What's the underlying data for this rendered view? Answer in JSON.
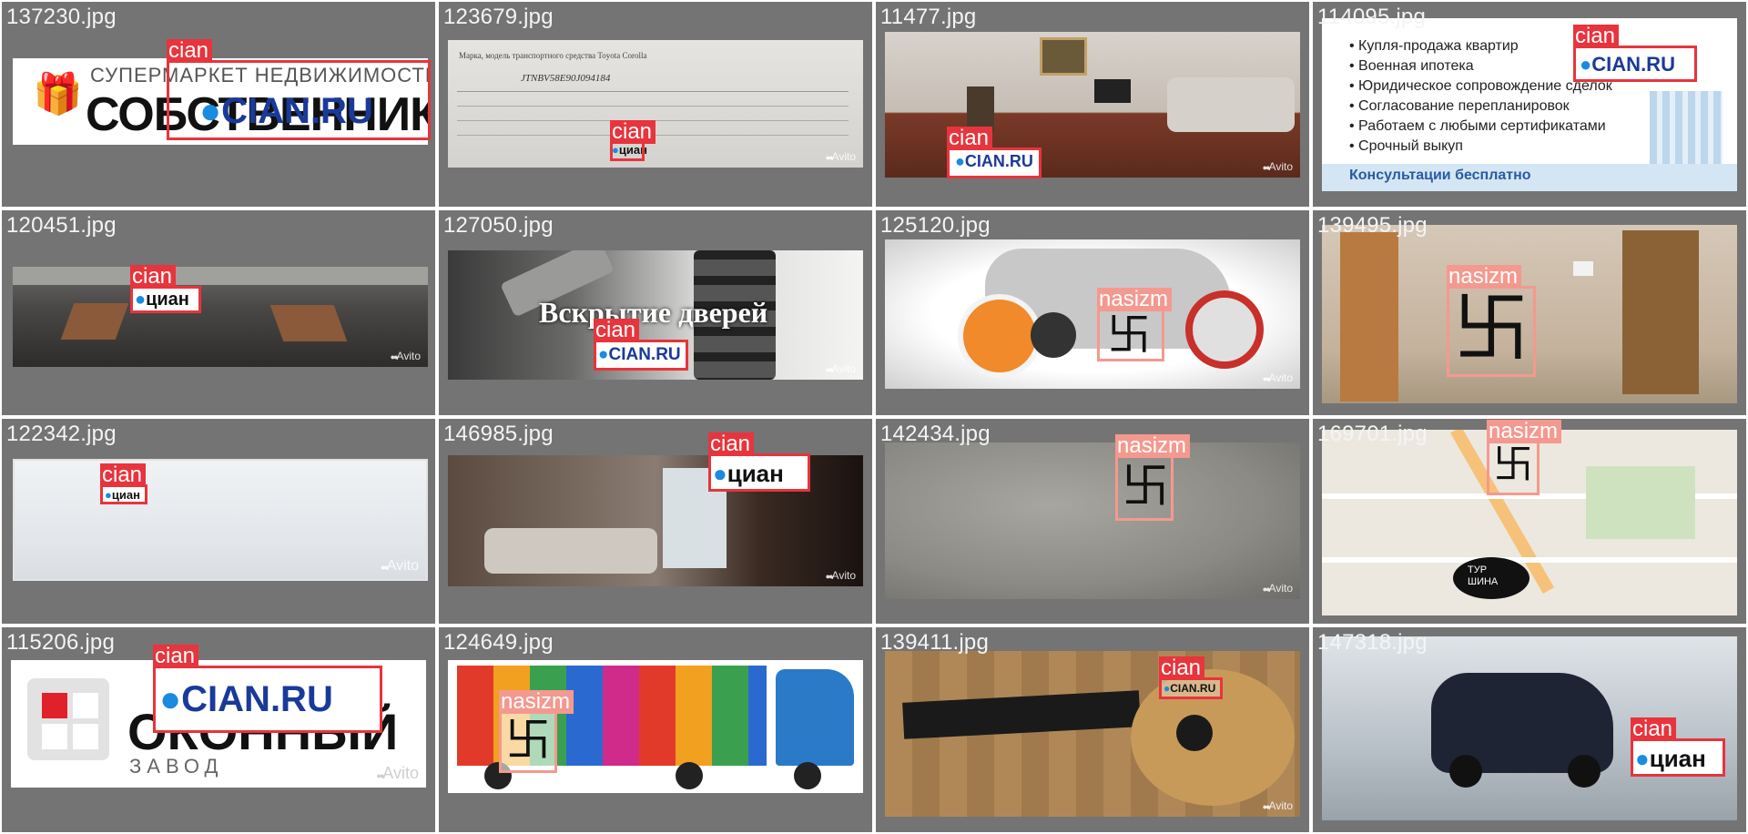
{
  "tiles": [
    {
      "filename": "137230.jpg",
      "label": "cian",
      "logo": "CIAN.RU",
      "banner_top": "СУПЕРМАРКЕТ НЕДВИЖИМОСТИ",
      "banner_main": "СОБСТВЕННИК"
    },
    {
      "filename": "123679.jpg",
      "label": "cian",
      "logo": "циан",
      "doc_text": "Марка, модель транспортного средства Toyota Corolla",
      "doc_code": "JTNBV58E90J094184"
    },
    {
      "filename": "11477.jpg",
      "label": "cian",
      "logo": "CIAN.RU"
    },
    {
      "filename": "114095.jpg",
      "label": "cian",
      "logo": "CIAN.RU",
      "bullets": [
        "Купля-продажа квартир",
        "Военная ипотека",
        "Юридическое сопровождение сделок",
        "Согласование перепланировок",
        "Работаем с любыми сертификатами",
        "Срочный выкуп"
      ],
      "footer": "Консультации бесплатно"
    },
    {
      "filename": "120451.jpg",
      "label": "cian",
      "logo": "циан"
    },
    {
      "filename": "127050.jpg",
      "label": "cian",
      "logo": "CIAN.RU",
      "overlay": "Вскрытие дверей"
    },
    {
      "filename": "125120.jpg",
      "label": "nasizm"
    },
    {
      "filename": "139495.jpg",
      "label": "nasizm"
    },
    {
      "filename": "122342.jpg",
      "label": "cian",
      "logo": "циан"
    },
    {
      "filename": "146985.jpg",
      "label": "cian",
      "logo": "циан"
    },
    {
      "filename": "142434.jpg",
      "label": "nasizm"
    },
    {
      "filename": "169701.jpg",
      "label": "nasizm",
      "map_bubble": "ТУР ШИНА"
    },
    {
      "filename": "115206.jpg",
      "label": "cian",
      "logo": "CIAN.RU",
      "banner_main": "ОКОННЫЙ",
      "banner_sub": "ЗАВОД"
    },
    {
      "filename": "124649.jpg",
      "label": "nasizm"
    },
    {
      "filename": "139411.jpg",
      "label": "cian",
      "logo": "CIAN.RU"
    },
    {
      "filename": "147318.jpg",
      "label": "cian",
      "logo": "циан"
    }
  ],
  "watermark": "Avito",
  "colors": {
    "cian": "#e8343c",
    "nasizm": "#f4998f",
    "tile_bg": "#747474"
  }
}
